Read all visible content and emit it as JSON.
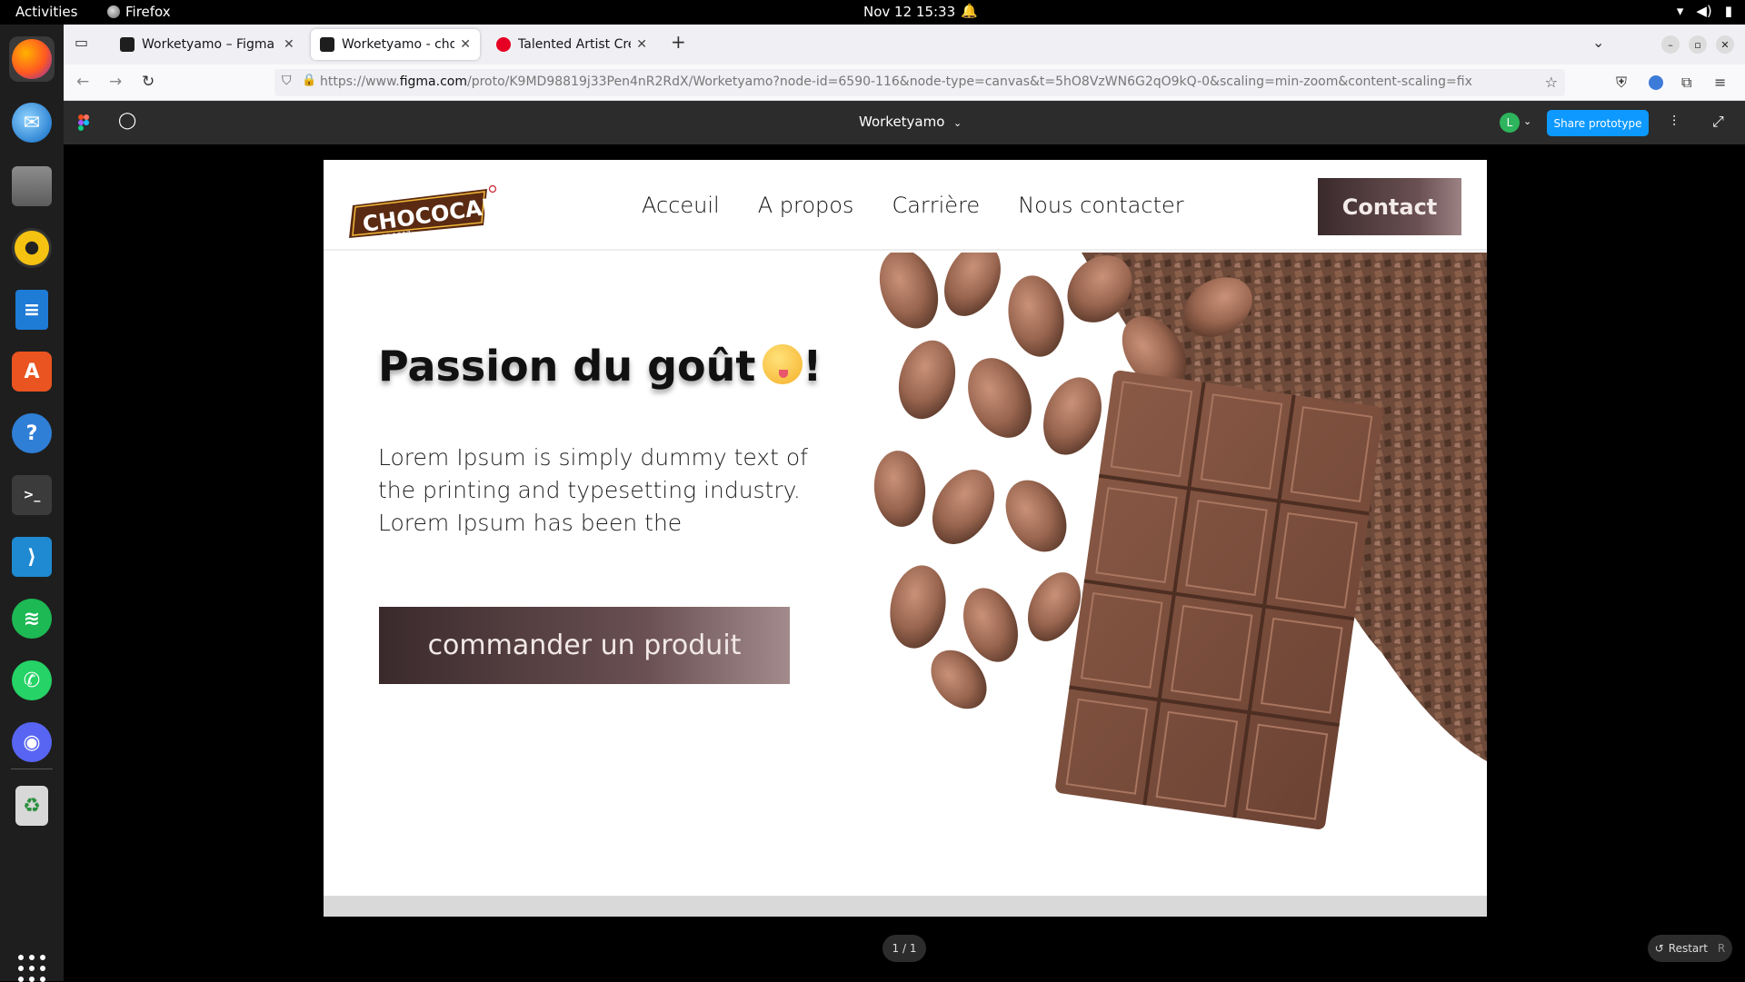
{
  "topbar": {
    "activities": "Activities",
    "app_name": "Firefox",
    "clock": "Nov 12  15:33"
  },
  "browser": {
    "tabs": [
      {
        "label": "Worketyamo – Figma",
        "favicon_color": "#1e1e1e"
      },
      {
        "label": "Worketyamo - chococam",
        "favicon_color": "#1e1e1e"
      },
      {
        "label": "Talented Artist Creates C",
        "favicon_color": "#e60023"
      }
    ],
    "url_prefix": "https://www.",
    "url_domain": "figma.com",
    "url_rest": "/proto/K9MD98819j33Pen4nR2RdX/Worketyamo?node-id=6590-116&node-type=canvas&t=5hO8VzWN6G2qO9kQ-0&scaling=min-zoom&content-scaling=fix"
  },
  "figma": {
    "file_name": "Worketyamo",
    "avatar_initial": "L",
    "share_label": "Share prototype",
    "page_counter": "1 / 1",
    "restart_label": "Restart",
    "restart_key": "R"
  },
  "site": {
    "logo_text": "CHOCOCAM",
    "logo_tagline": "SINCE 1967",
    "nav": [
      "Acceuil",
      "A propos",
      "Carrière",
      "Nous contacter"
    ],
    "contact_label": "Contact",
    "hero_title": "Passion du goût",
    "hero_title_suffix": "!",
    "hero_text": "Lorem Ipsum is simply dummy text of the printing and typesetting industry. Lorem Ipsum has been the",
    "order_label": "commander un produit"
  },
  "colors": {
    "figma_blue": "#0d99ff",
    "chocolate_dark": "#3a2a2c",
    "chocolate_light": "#a38b8c",
    "logo_brown": "#5a2a12",
    "logo_red": "#c8202a"
  }
}
